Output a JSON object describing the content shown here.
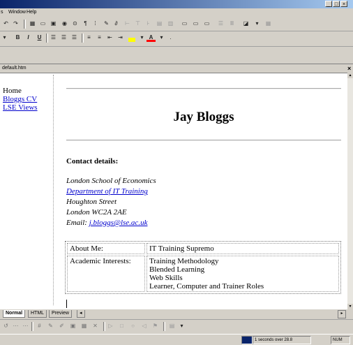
{
  "menubar": {
    "items": [
      "Window",
      "Help"
    ],
    "prefix": "s"
  },
  "toolbar2": {
    "bold": "B",
    "italic": "I",
    "underline": "U"
  },
  "doc": {
    "tab": "default.htm",
    "close": "×"
  },
  "nav": {
    "home": "Home",
    "cv": "Bloggs CV",
    "lse": "LSE Views"
  },
  "page": {
    "title": "Jay Bloggs",
    "contact_heading": "Contact details:",
    "address": {
      "line1": "London School of Economics",
      "line2": "Department of IT Training",
      "line3": "Houghton Street",
      "line4": "London WC2A 2AE",
      "email_label": "Email: ",
      "email": "j.bloggs@lse.ac.uk"
    },
    "table": {
      "row1": {
        "label": "About Me:",
        "value": "IT Training Supremo"
      },
      "row2": {
        "label": "Academic Interests:",
        "values": [
          "Training Methodology",
          "Blended Learning",
          "Web Skills",
          "Learner, Computer and Trainer Roles"
        ]
      }
    }
  },
  "viewtabs": {
    "normal": "Normal",
    "html": "HTML",
    "preview": "Preview"
  },
  "status": {
    "speed": "1 seconds over 28.8",
    "mode": "NUM"
  }
}
